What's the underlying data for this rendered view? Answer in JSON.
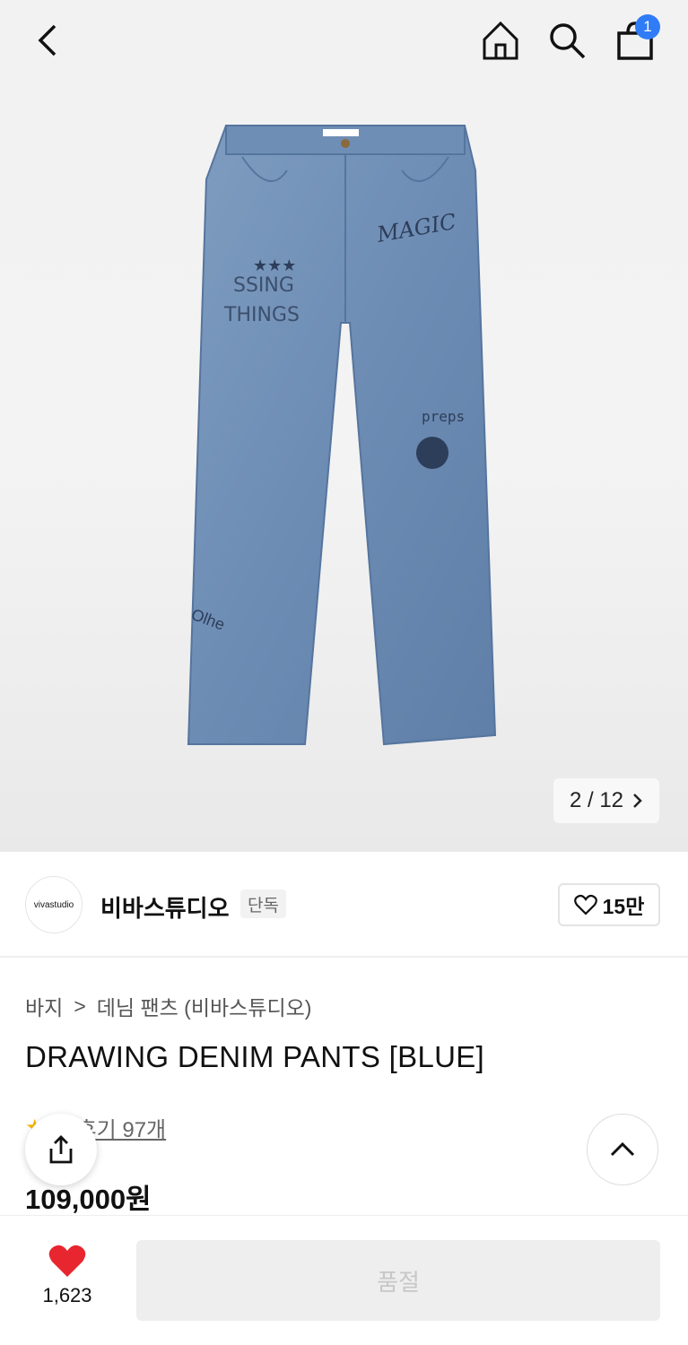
{
  "header": {
    "back_icon": "chevron-left-icon",
    "home_icon": "home-icon",
    "search_icon": "search-icon",
    "bag_icon": "shopping-bag-icon",
    "cart_count": "1"
  },
  "gallery": {
    "pager": "2 / 12",
    "pager_icon": "chevron-right-icon"
  },
  "brand": {
    "logo_text": "vivastudio",
    "name": "비바스튜디오",
    "tag": "단독",
    "like_icon": "heart-outline-icon",
    "like_count": "15만"
  },
  "product": {
    "breadcrumb": [
      "바지",
      ">",
      "데님 팬츠 (비바스튜디오)"
    ],
    "title": "DRAWING DENIM PANTS [BLUE]",
    "reviews": "후기 97개",
    "price": "109,000원"
  },
  "bottom": {
    "wish_count": "1,623",
    "buy_button": "품절"
  },
  "colors": {
    "accent": "#2f7cf6",
    "heart": "#e8262f",
    "star": "#f5b800"
  }
}
